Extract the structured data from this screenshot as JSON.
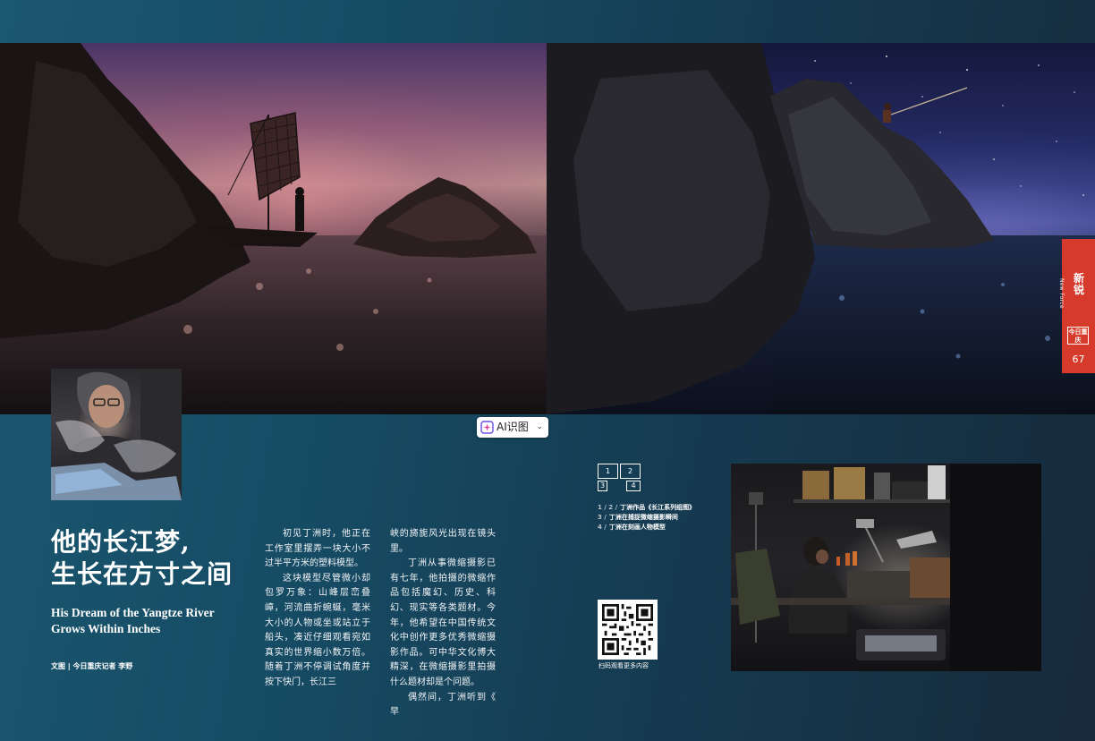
{
  "side_tab": {
    "section_cn": "新锐",
    "section_en": "New Force",
    "logo": "今日重庆",
    "page_number": "67"
  },
  "ai_badge": {
    "label": "AI识图",
    "icon": "ai-sparkle-icon",
    "chevron": "chevron-down-icon"
  },
  "headline": {
    "cn_line1": "他的长江梦,",
    "cn_line2": "生长在方寸之间",
    "en_line1": "His Dream of the Yangtze River",
    "en_line2": "Grows Within Inches"
  },
  "byline": "文图 | 今日重庆记者 李野",
  "body": {
    "col1_p1": "初见丁洲时，他正在工作室里摆弄一块大小不过半平方米的塑料模型。",
    "col1_p2": "这块模型尽管微小却包罗万象：山峰层峦叠嶂，河流曲折蜿蜒，毫米大小的人物或坐或站立于船头，凑近仔细观看宛如真实的世界缩小数万倍。随着丁洲不停调试角度并按下快门，长江三",
    "col2_p1": "峡的旖旎风光出现在镜头里。",
    "col2_p2": "丁洲从事微缩摄影已有七年，他拍摄的微缩作品包括魔幻、历史、科幻、现实等各类题材。今年，他希望在中国传统文化中创作更多优秀微缩摄影作品。可中华文化博大精深，在微缩摄影里拍摄什么题材却是个问题。",
    "col2_p3": "偶然间，丁洲听到《 早"
  },
  "caption_key": {
    "boxes": [
      "1",
      "2",
      "3",
      "4"
    ]
  },
  "captions": [
    {
      "num": "1 / 2 /",
      "text": "丁洲作品《长江系列组图》"
    },
    {
      "num": "3 /",
      "text": "丁洲在捕捉微缩摄影瞬间"
    },
    {
      "num": "4 /",
      "text": "丁洲在刻画人物模型"
    }
  ],
  "qr": {
    "label": "扫码观看更多内容"
  },
  "colors": {
    "accent_red": "#d63a2b",
    "bg_teal": "#164a63",
    "bg_navy": "#172a3b"
  }
}
